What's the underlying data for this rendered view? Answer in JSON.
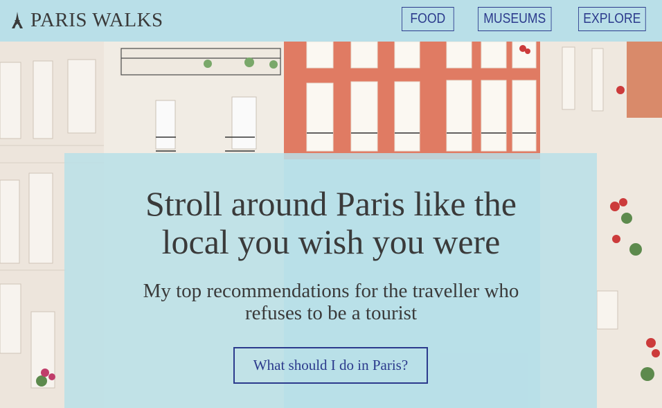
{
  "header": {
    "brand": "PARIS WALKS",
    "logo_icon": "eiffel-tower-icon",
    "nav": [
      {
        "label": "FOOD"
      },
      {
        "label": "MUSEUMS"
      },
      {
        "label": "EXPLORE"
      }
    ]
  },
  "hero": {
    "title_line1": "Stroll around Paris like the",
    "title_line2": "local you wish you were",
    "subtitle_line1": "My top recommendations for the traveller who",
    "subtitle_line2": "refuses to be a tourist",
    "cta_label": "What should I do in Paris?"
  },
  "colors": {
    "header_bg": "#b9dfe8",
    "accent": "#2b3a8c",
    "text": "#3a3a3a",
    "brick": "#e07b63"
  }
}
